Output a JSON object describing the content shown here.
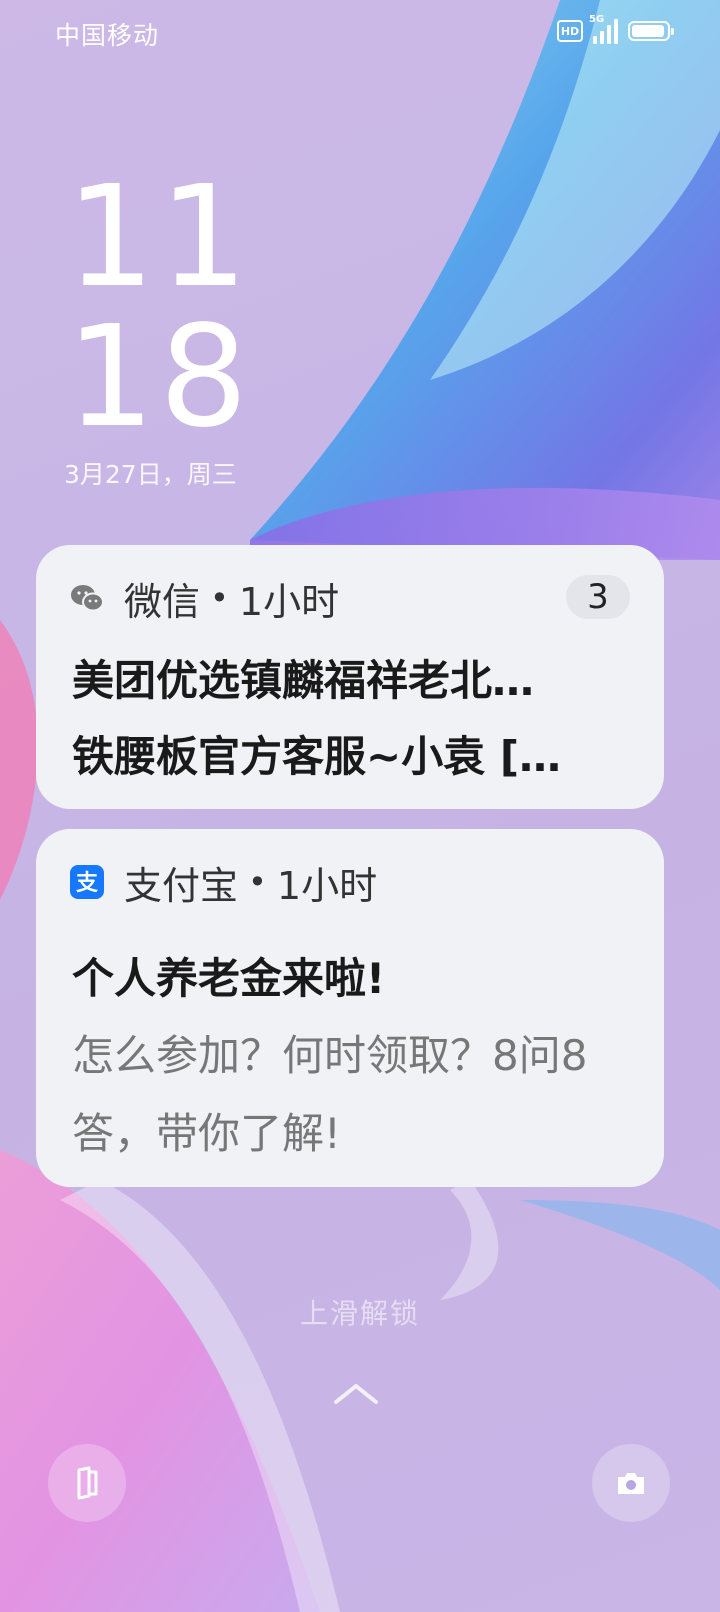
{
  "status_bar": {
    "carrier": "中国移动",
    "hd_label": "HD",
    "network_label": "5G",
    "battery_level": 0.95
  },
  "clock": {
    "hour": "11",
    "minute": "18",
    "date": "3月27日，周三"
  },
  "notifications": [
    {
      "app": "微信",
      "separator": "•",
      "time": "1小时",
      "count": "3",
      "line1": "美团优选镇麟福祥老北…",
      "line2": "铁腰板官方客服~小袁 […",
      "icon": "wechat-icon",
      "icon_color": "#7a7a7a"
    },
    {
      "app": "支付宝",
      "separator": "•",
      "time": "1小时",
      "title": "个人养老金来啦!",
      "body": "怎么参加？何时领取？8问8答，带你了解!",
      "icon": "alipay-icon",
      "icon_color": "#1677ff"
    }
  ],
  "lock": {
    "unlock_hint": "上滑解锁",
    "left_shortcut_icon": "phone-icon",
    "right_shortcut_icon": "camera-icon"
  }
}
